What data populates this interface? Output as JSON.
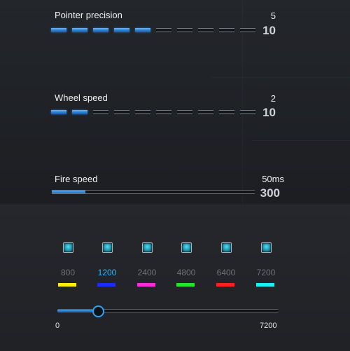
{
  "pointer_precision": {
    "label": "Pointer precision",
    "value": 5,
    "value_text": "5",
    "max_text": "10",
    "segments_total": 10
  },
  "wheel_speed": {
    "label": "Wheel speed",
    "value": 2,
    "value_text": "2",
    "max_text": "10",
    "segments_total": 10
  },
  "fire_speed": {
    "label": "Fire speed",
    "value_text": "50ms",
    "max_text": "300",
    "fill_fraction": 0.166
  },
  "dpi": {
    "presets": [
      {
        "label": "800",
        "color": "#ffee00",
        "active": false,
        "icon": "checkbox-icon"
      },
      {
        "label": "1200",
        "color": "#1a2cff",
        "active": true,
        "icon": "checkbox-icon"
      },
      {
        "label": "2400",
        "color": "#ff2bd6",
        "active": false,
        "icon": "checkbox-icon"
      },
      {
        "label": "4800",
        "color": "#23e62a",
        "active": false,
        "icon": "checkbox-icon"
      },
      {
        "label": "6400",
        "color": "#ff1f1f",
        "active": false,
        "icon": "checkbox-icon"
      },
      {
        "label": "7200",
        "color": "#18f2f2",
        "active": false,
        "icon": "checkbox-icon"
      }
    ],
    "slider_min_text": "0",
    "slider_max_text": "7200",
    "slider_value": 1200,
    "slider_max": 7200
  },
  "colors": {
    "accent": "#2aa3f5",
    "active_label": "#35b6ff"
  }
}
